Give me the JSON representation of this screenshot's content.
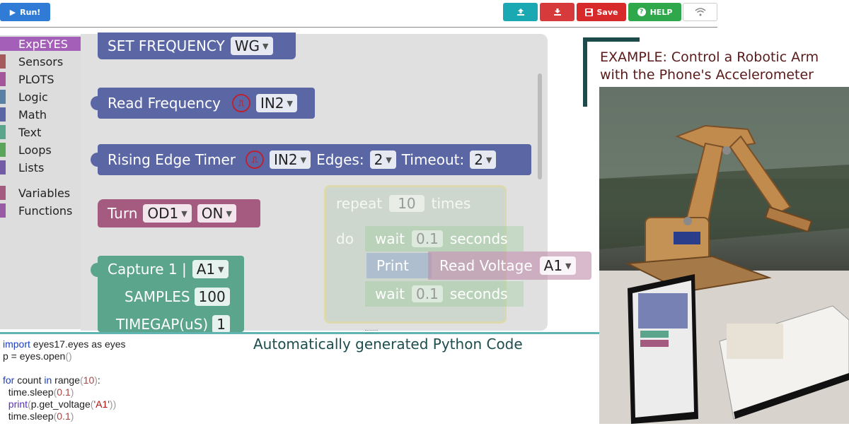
{
  "toolbar": {
    "run_label": "Run!",
    "save_label": "Save",
    "help_label": "HELP",
    "colors": {
      "run": "#2f7bd6",
      "upload": "#1aa8b3",
      "download": "#d63a3a",
      "save": "#d72b2b",
      "help": "#2ea84a"
    }
  },
  "toolbox": {
    "items": [
      {
        "label": "ExpEYES",
        "color": "#a45fb8",
        "selected": true
      },
      {
        "label": "Sensors",
        "color": "#a55b5b"
      },
      {
        "label": "PLOTS",
        "color": "#a5559a"
      },
      {
        "label": "Logic",
        "color": "#5b80a5"
      },
      {
        "label": "Math",
        "color": "#5b67a5"
      },
      {
        "label": "Text",
        "color": "#5ba58c"
      },
      {
        "label": "Loops",
        "color": "#5ba55b"
      },
      {
        "label": "Lists",
        "color": "#745ba5"
      },
      {
        "label": "Variables",
        "color": "#a55b80"
      },
      {
        "label": "Functions",
        "color": "#995ba5"
      }
    ]
  },
  "blocks": {
    "set_frequency": {
      "label": "SET FREQUENCY",
      "option": "WG"
    },
    "read_frequency": {
      "label": "Read Frequency",
      "option": "IN2"
    },
    "rising_edge": {
      "label": "Rising Edge Timer",
      "option": "IN2",
      "edges_label": "Edges:",
      "edges": "2",
      "timeout_label": "Timeout:",
      "timeout": "2"
    },
    "turn": {
      "label": "Turn",
      "output": "OD1",
      "state": "ON"
    },
    "capture": {
      "label": "Capture 1 |",
      "channel": "A1",
      "samples_label": "SAMPLES",
      "samples": "100",
      "timegap_label": "TIMEGAP(uS)",
      "timegap": "1"
    }
  },
  "ghost_program": {
    "repeat": "repeat",
    "times_value": "10",
    "times": "times",
    "do": "do",
    "wait1": "wait",
    "wait1_value": "0.1",
    "seconds1": "seconds",
    "print": "Print",
    "read_voltage": "Read Voltage",
    "channel": "A1",
    "wait2": "wait",
    "wait2_value": "0.1",
    "seconds2": "seconds"
  },
  "code_panel": {
    "title": "Automatically generated Python Code",
    "lines": {
      "l1_kw": "import",
      "l1_rest": " eyes17.eyes as eyes",
      "l2": "p = eyes.open",
      "l4_for": "for",
      "l4_mid": " count ",
      "l4_in": "in",
      "l4_range": " range",
      "l4_num": "10",
      "l5": "  time.sleep",
      "l5_num": "0.1",
      "l6_print": "  print",
      "l6_call": "p.get_voltage",
      "l6_str": "'A1'",
      "l7": "  time.sleep",
      "l7_num": "0.1"
    }
  },
  "example": {
    "line1": "EXAMPLE: Control a Robotic Arm",
    "line2": "with the Phone's Accelerometer"
  }
}
